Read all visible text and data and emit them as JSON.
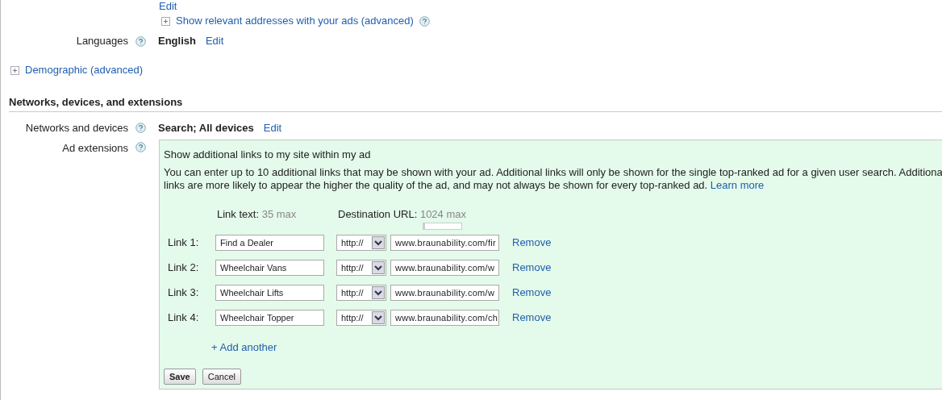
{
  "top_link": "Edit",
  "addresses_toggle": {
    "label": "Show relevant addresses with your ads (advanced)",
    "expanded": false
  },
  "languages": {
    "label": "Languages",
    "value": "English",
    "edit": "Edit"
  },
  "demographic_toggle": {
    "label": "Demographic (advanced)",
    "expanded": false
  },
  "section_title": "Networks, devices, and extensions",
  "networks": {
    "label": "Networks and devices",
    "value": "Search; All devices",
    "edit": "Edit"
  },
  "ad_extensions": {
    "label": "Ad extensions",
    "heading": "Show additional links to my site within my ad",
    "description_lines": [
      "You can enter up to 10 additional links that may be shown with your ad. Additional links will only be shown for the single top-ranked ad for a given user search. Additiona",
      "links are more likely to appear the higher the quality of the ad, and may not always be shown for every top-ranked ad."
    ],
    "learn_more": "Learn more",
    "link_text_header": "Link text:",
    "link_text_limit": "35 max",
    "url_header": "Destination URL:",
    "url_limit": "1024 max",
    "url_meter": {
      "level": 0.05
    },
    "links": [
      {
        "label": "Link 1:",
        "text": "Find a Dealer",
        "protocol": "http://",
        "url": "www.braunability.com/fir",
        "remove": "Remove"
      },
      {
        "label": "Link 2:",
        "text": "Wheelchair Vans",
        "protocol": "http://",
        "url": "www.braunability.com/w",
        "remove": "Remove"
      },
      {
        "label": "Link 3:",
        "text": "Wheelchair Lifts",
        "protocol": "http://",
        "url": "www.braunability.com/w",
        "remove": "Remove"
      },
      {
        "label": "Link 4:",
        "text": "Wheelchair Topper",
        "protocol": "http://",
        "url": "www.braunability.com/ch",
        "remove": "Remove"
      }
    ],
    "add_another": "+ Add another",
    "buttons": {
      "save": "Save",
      "cancel": "Cancel"
    }
  }
}
